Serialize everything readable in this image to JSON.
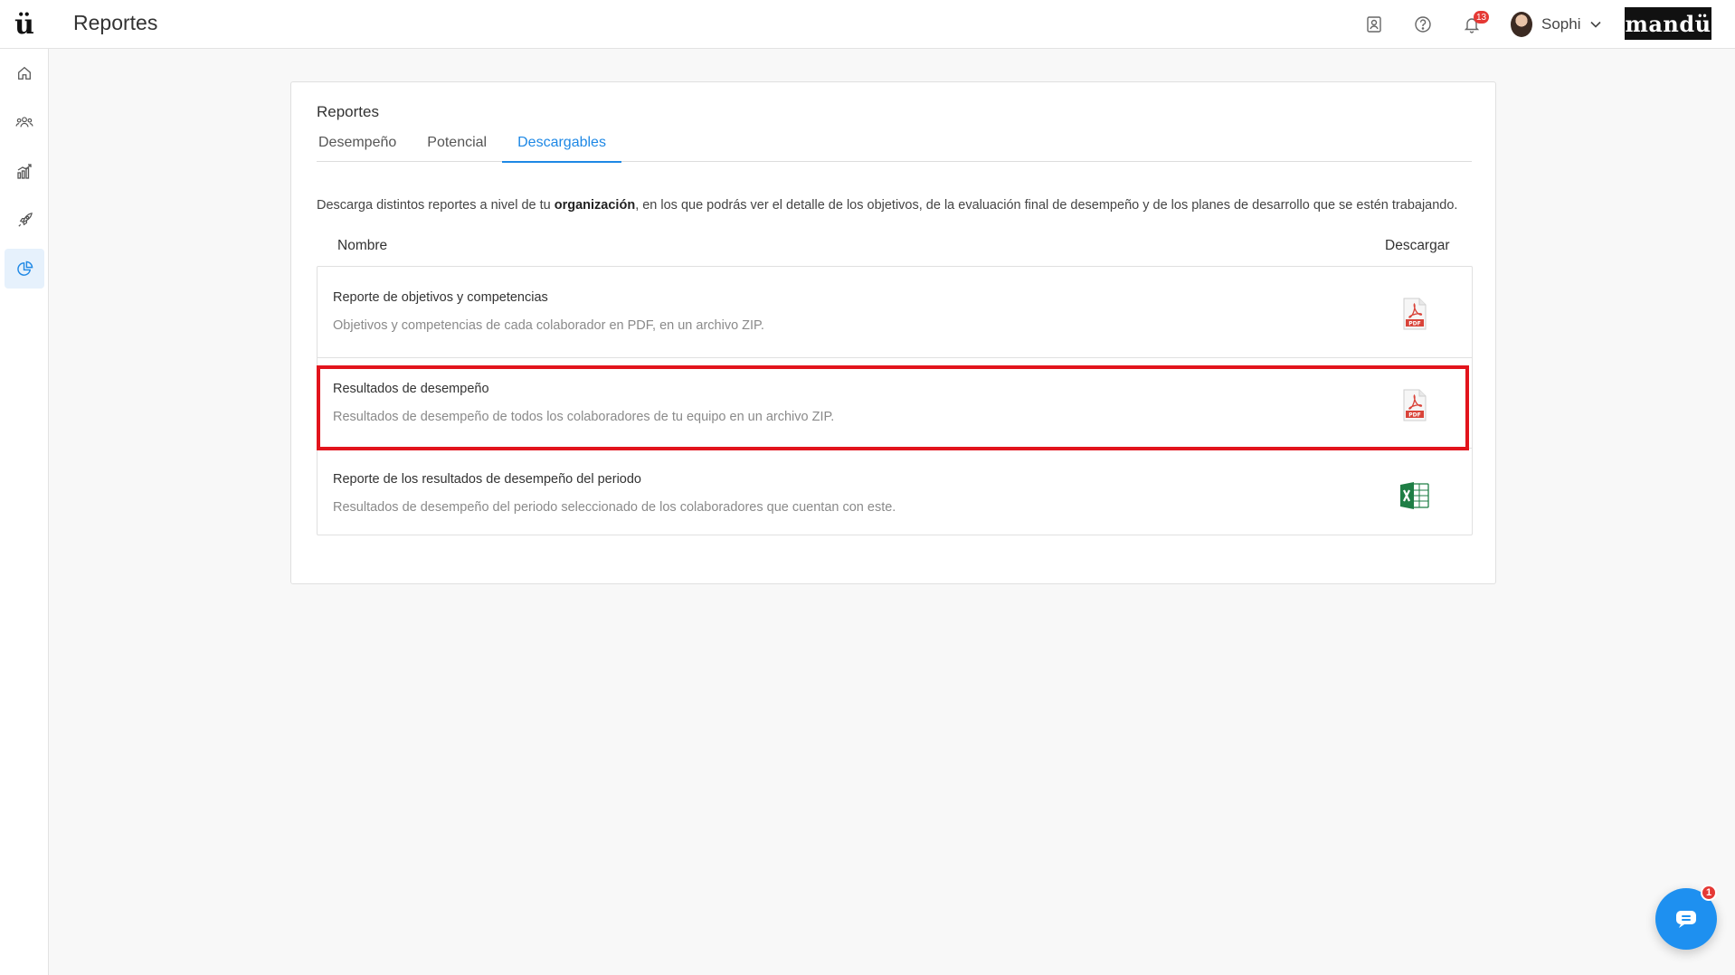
{
  "header": {
    "logo": "ü",
    "title": "Reportes",
    "notifications_count": "13",
    "user_name": "Sophi",
    "brand": "mandü"
  },
  "sidebar": {
    "items": [
      {
        "icon": "home-icon"
      },
      {
        "icon": "people-icon"
      },
      {
        "icon": "growth-chart-icon"
      },
      {
        "icon": "rocket-icon"
      },
      {
        "icon": "pie-chart-icon",
        "active": true
      }
    ]
  },
  "card": {
    "title": "Reportes",
    "tabs": [
      {
        "label": "Desempeño"
      },
      {
        "label": "Potencial"
      },
      {
        "label": "Descargables",
        "active": true
      }
    ],
    "description": {
      "before": "Descarga distintos reportes a nivel de tu ",
      "bold": "organización",
      "after": ", en los que podrás ver el detalle de los objetivos, de la evaluación final de desempeño y de los planes de desarrollo que se estén trabajando."
    },
    "table": {
      "col_name": "Nombre",
      "col_download": "Descargar",
      "rows": [
        {
          "title": "Reporte de objetivos y competencias",
          "subtitle": "Objetivos y competencias de cada colaborador en PDF, en un archivo ZIP.",
          "file_type": "PDF"
        },
        {
          "title": "Resultados de desempeño",
          "subtitle": "Resultados de desempeño de todos los colaboradores de tu equipo en un archivo ZIP.",
          "file_type": "PDF"
        },
        {
          "title": "Reporte de los resultados de desempeño del periodo",
          "subtitle": "Resultados de desempeño del periodo seleccionado de los colaboradores que cuentan con este.",
          "file_type": "Excel"
        }
      ]
    }
  },
  "chat": {
    "badge": "1"
  },
  "colors": {
    "accent": "#1e88e5",
    "highlight": "#e2141c",
    "pdf": "#d9443a",
    "excel": "#1e7e45"
  }
}
